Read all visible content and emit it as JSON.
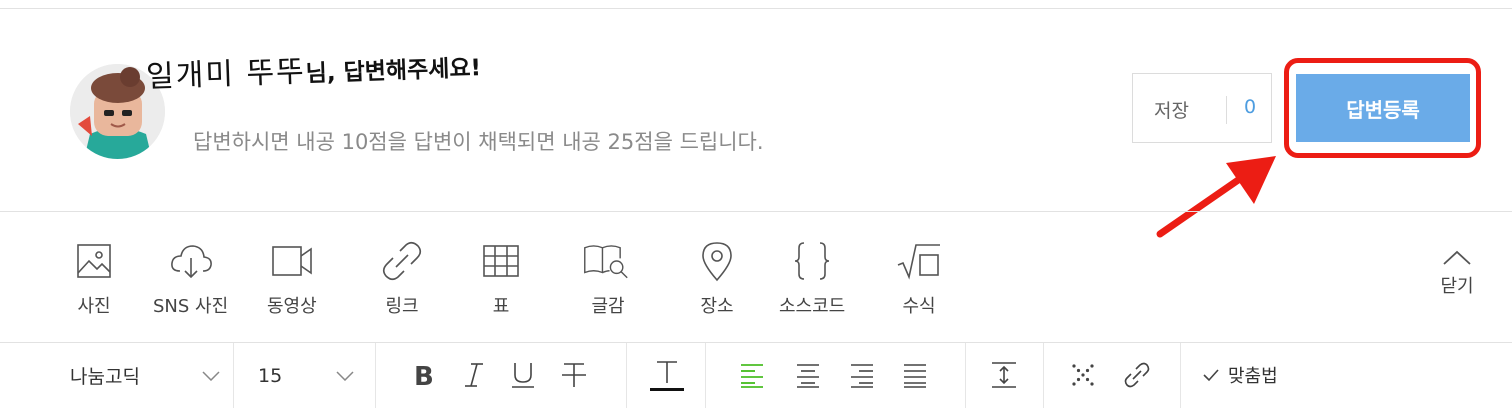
{
  "header": {
    "nickname": "일개미 뚜뚜",
    "greeting_suffix": "님, 답변해주세요!",
    "subtitle": "답변하시면 내공 10점을 답변이 채택되면 내공 25점을 드립니다.",
    "save_label": "저장",
    "save_count": "0",
    "submit_label": "답변등록"
  },
  "insert_toolbar": {
    "items": [
      {
        "label": "사진",
        "icon": "image-icon"
      },
      {
        "label": "SNS 사진",
        "icon": "cloud-download-icon"
      },
      {
        "label": "동영상",
        "icon": "video-camera-icon"
      },
      {
        "label": "링크",
        "icon": "link-icon"
      },
      {
        "label": "표",
        "icon": "table-icon"
      },
      {
        "label": "글감",
        "icon": "book-search-icon"
      },
      {
        "label": "장소",
        "icon": "map-pin-icon"
      },
      {
        "label": "소스코드",
        "icon": "curly-braces-icon"
      },
      {
        "label": "수식",
        "icon": "square-root-icon"
      }
    ],
    "close_label": "닫기"
  },
  "format_toolbar": {
    "font_family": "나눔고딕",
    "font_size": "15",
    "spellcheck_label": "맞춤법"
  },
  "colors": {
    "accent_blue": "#6aabe8",
    "count_blue": "#4d9de0",
    "highlight_red": "#ec1d14",
    "align_active_green": "#2db400"
  }
}
